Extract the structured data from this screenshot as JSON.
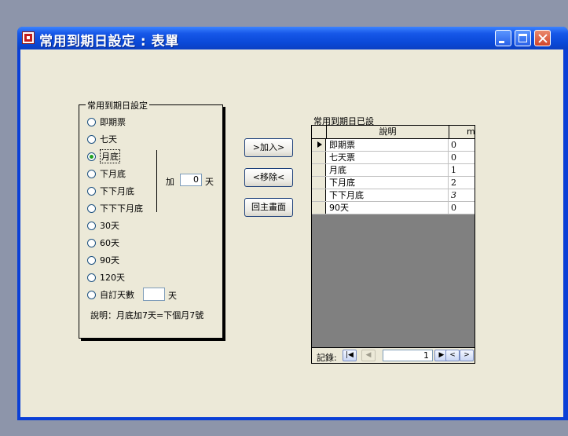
{
  "window": {
    "title": "常用到期日設定 : 表單"
  },
  "group": {
    "title": "常用到期日設定",
    "options": [
      {
        "label": "即期票",
        "checked": false
      },
      {
        "label": "七天",
        "checked": false
      },
      {
        "label": "月底",
        "checked": true
      },
      {
        "label": "下月底",
        "checked": false
      },
      {
        "label": "下下月底",
        "checked": false
      },
      {
        "label": "下下下月底",
        "checked": false
      },
      {
        "label": "30天",
        "checked": false
      },
      {
        "label": "60天",
        "checked": false
      },
      {
        "label": "90天",
        "checked": false
      },
      {
        "label": "120天",
        "checked": false
      },
      {
        "label": "自訂天數",
        "checked": false
      }
    ],
    "add_label": "加",
    "add_days_value": "0",
    "add_days_unit": "天",
    "custom_days_value": "",
    "custom_days_unit": "天",
    "note": "說明：月底加7天=下個月7號"
  },
  "buttons": {
    "add": ">加入>",
    "remove": "<移除<",
    "home": "回主畫面"
  },
  "subform": {
    "caption": "常用到期日已設",
    "headers": [
      "說明",
      "m"
    ],
    "rows": [
      {
        "desc": "即期票",
        "m": "0"
      },
      {
        "desc": "七天票",
        "m": "0"
      },
      {
        "desc": "月底",
        "m": "1"
      },
      {
        "desc": "下月底",
        "m": "2"
      },
      {
        "desc": "下下月底",
        "m": "3"
      },
      {
        "desc": "90天",
        "m": "0"
      }
    ],
    "nav": {
      "label": "記錄:",
      "record_number": "1"
    }
  }
}
